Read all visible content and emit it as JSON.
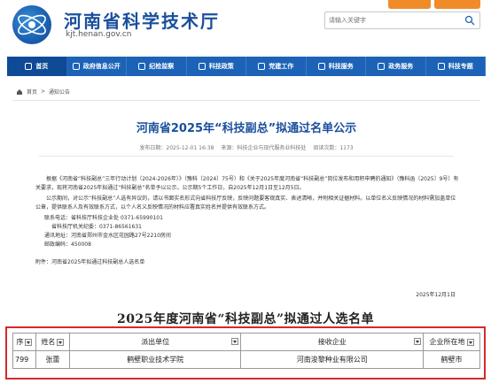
{
  "header": {
    "site_title": "河南省科学技术厅",
    "site_url": "kjt.henan.gov.cn",
    "search_placeholder": "请输入关键字"
  },
  "nav": {
    "items": [
      {
        "label": "首页",
        "icon": "home-icon",
        "active": true
      },
      {
        "label": "政府信息公开",
        "icon": "document-icon"
      },
      {
        "label": "纪检监察",
        "icon": "book-icon"
      },
      {
        "label": "科技政策",
        "icon": "policy-icon"
      },
      {
        "label": "党建工作",
        "icon": "star-icon"
      },
      {
        "label": "科技服务",
        "icon": "service-icon"
      },
      {
        "label": "政务服务",
        "icon": "grid-icon"
      },
      {
        "label": "科技专题",
        "icon": "topic-icon"
      }
    ]
  },
  "breadcrumb": {
    "home": "首页",
    "sep": ">",
    "current": "通知公告"
  },
  "article": {
    "title": "河南省2025年“科技副总”拟通过名单公示",
    "publish_time": "发布日期：2025-12-01 16:38",
    "source": "来源：科技企业与现代服务业科技处",
    "views": "阅读次数：1173",
    "para1": "根据《河南省“科技副总”三年行动计划（2024-2026年）》（豫科〔2024〕75号）和《关于2025年度河南省“科技副总”岗位发布和用积申聘的通知》（豫科函〔2025〕9号）有关要求，现将河南省2025年拟通过“科技副总”名单予以公示，公示期5个工作日，自2025年12月1日至12月5日。",
    "para2": "公示期间，对公示“科技副总”人选有异议的，请以书面实名形式向省科技厅反映，反映问题要客观真实、表述清晰，并附相关证据材料。以单位名义反映情况的材料需加盖单位公章，提供联系人及有效联系方式，以个人名义反映情况的材料应署真实姓名并提供有效联系方式。",
    "contact_label": "联系电话：省科技厅科技企业处",
    "phone1": "0371-65990101",
    "phone2_label": "省科技厅机关纪委：",
    "phone2": "0371-86561631",
    "address": "通讯地址：河南省郑州市金水区花园路27号2210房间",
    "postcode": "邮政编码：450008",
    "attachment": "附件：河南省2025年拟通过科技副总人选名单",
    "date": "2025年12月1日"
  },
  "table": {
    "title": "2025年度河南省“科技副总”拟通过人选名单",
    "headers": [
      "序号",
      "姓名",
      "派出单位",
      "接收企业",
      "企业所在地"
    ],
    "header_short_first": "序",
    "rows": [
      [
        "799",
        "张蕾",
        "鹤壁职业技术学院",
        "河南浚黎种业有限公司",
        "鹤壁市"
      ]
    ]
  },
  "colors": {
    "brand_blue": "#1c63b8",
    "title_blue": "#1a4f9c",
    "highlight_red": "#d42a2a",
    "top_button_orange": "#f08b2a"
  }
}
